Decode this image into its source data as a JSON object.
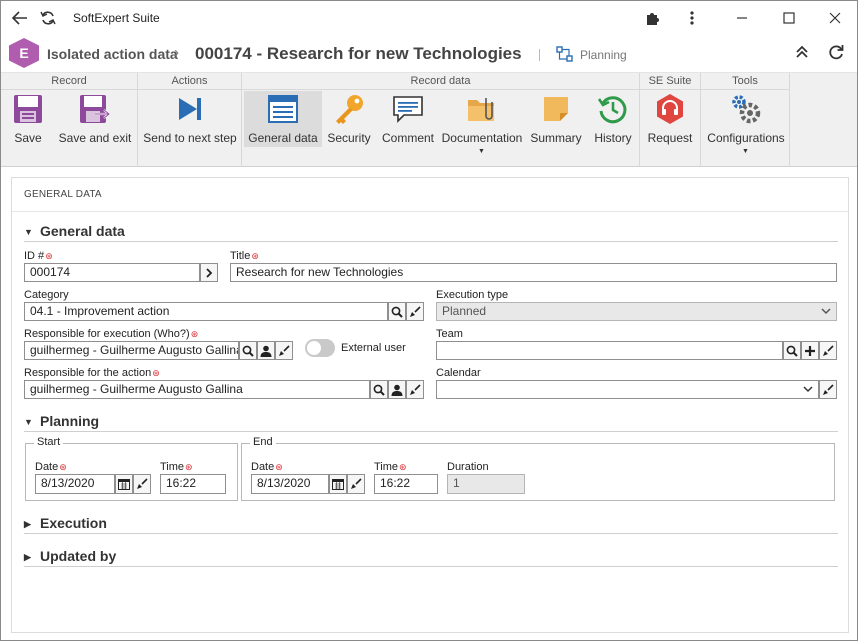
{
  "window": {
    "title": "SoftExpert Suite"
  },
  "header": {
    "logo": "E",
    "module": "Isolated action data",
    "record": "000174 - Research for new Technologies",
    "planning_label": "Planning"
  },
  "toolbar": {
    "groups": {
      "record": "Record",
      "actions": "Actions",
      "record_data": "Record data",
      "se_suite": "SE Suite",
      "tools": "Tools"
    },
    "save": "Save",
    "save_exit": "Save and exit",
    "send_next": "Send to next step",
    "general_data": "General data",
    "security": "Security",
    "comment": "Comment",
    "documentation": "Documentation",
    "summary": "Summary",
    "history": "History",
    "request": "Request",
    "configurations": "Configurations"
  },
  "content": {
    "panel_title": "GENERAL DATA",
    "general_section": "General data",
    "id_label": "ID #",
    "id_value": "000174",
    "title_label": "Title",
    "title_value": "Research for new Technologies",
    "category_label": "Category",
    "category_value": "04.1 - Improvement action",
    "exec_type_label": "Execution type",
    "exec_type_value": "Planned",
    "resp_exec_label": "Responsible for execution (Who?)",
    "resp_exec_value": "guilhermeg - Guilherme Augusto Gallina",
    "external_user_label": "External user",
    "team_label": "Team",
    "team_value": "",
    "resp_action_label": "Responsible for the action",
    "resp_action_value": "guilhermeg - Guilherme Augusto Gallina",
    "calendar_label": "Calendar",
    "calendar_value": "",
    "planning_section": "Planning",
    "start_legend": "Start",
    "end_legend": "End",
    "date_label": "Date",
    "time_label": "Time",
    "duration_label": "Duration",
    "start_date": "8/13/2020",
    "start_time": "16:22",
    "end_date": "8/13/2020",
    "end_time": "16:22",
    "duration": "1",
    "execution_section": "Execution",
    "updated_section": "Updated by"
  },
  "colors": {
    "accent": "#2a6db5",
    "brand": "#b05db0",
    "required": "#d9272e"
  }
}
